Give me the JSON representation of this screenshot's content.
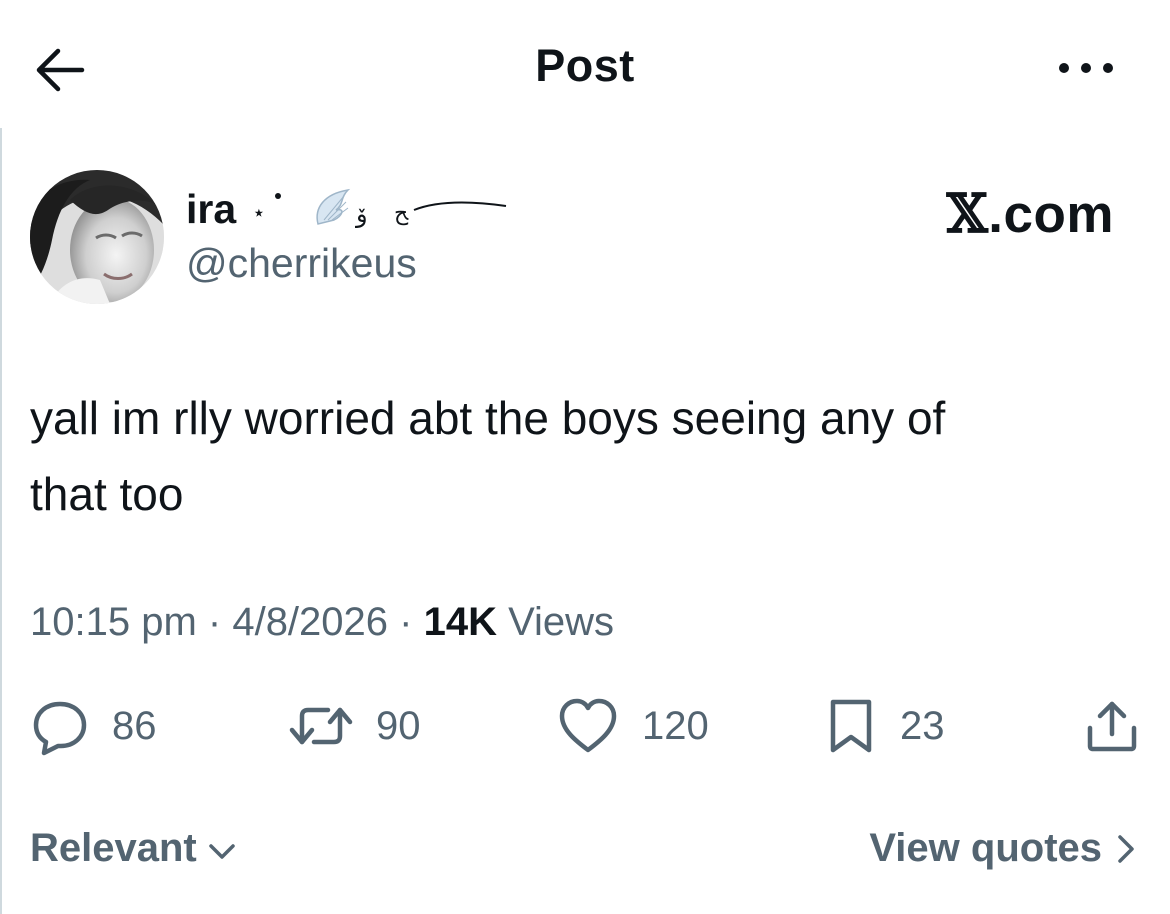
{
  "header": {
    "title": "Post",
    "back_icon": "arrow-left-icon",
    "more_icon": "more-horizontal-icon"
  },
  "author": {
    "display_name": "ira",
    "handle": "@cherrikeus"
  },
  "brand": {
    "x_glyph": "𝕏",
    "suffix": ".com"
  },
  "tweet": {
    "line1": "yall im rlly worried abt the boys seeing any of",
    "line2": "that too"
  },
  "meta": {
    "time": "10:15 pm",
    "separator": " · ",
    "date": "4/8/2026",
    "views_count": "14K",
    "views_label": " Views"
  },
  "actions": {
    "reply": {
      "icon": "reply-icon",
      "count": "86"
    },
    "repost": {
      "icon": "repost-icon",
      "count": "90"
    },
    "like": {
      "icon": "heart-icon",
      "count": "120"
    },
    "bookmark": {
      "icon": "bookmark-icon",
      "count": "23"
    },
    "share": {
      "icon": "share-icon"
    }
  },
  "footer": {
    "sort_label": "Relevant",
    "quotes_label": "View quotes"
  },
  "colors": {
    "text_primary": "#0f1419",
    "text_secondary": "#536471",
    "background": "#ffffff"
  }
}
